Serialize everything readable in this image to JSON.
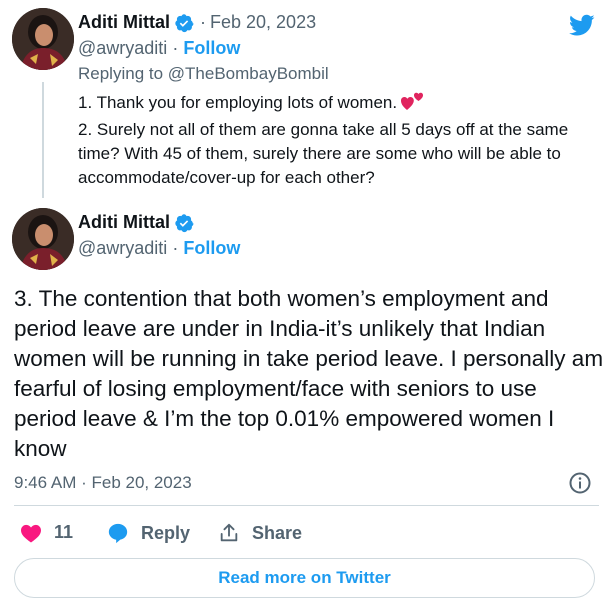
{
  "brand": {
    "accent": "#1d9bf0",
    "heart": "#f91880",
    "icon": "twitter-bird-icon"
  },
  "reply_tweet": {
    "author_name": "Aditi Mittal",
    "date": "Feb 20, 2023",
    "handle": "@awryaditi",
    "separator": "·",
    "follow_label": "Follow",
    "replying_to": "Replying to @TheBombayBombil",
    "lines": [
      "1. Thank you for employing lots of women.",
      "2. Surely not all of them are gonna take all 5 days off at the same time? With 45 of them, surely there are some who will be able to accommodate/cover-up for each other?"
    ]
  },
  "main_tweet": {
    "author_name": "Aditi Mittal",
    "handle": "@awryaditi",
    "separator": "·",
    "follow_label": "Follow",
    "text": "3. The contention that both women’s employment and period leave are under in India-it’s unlikely that Indian women will be running in take period leave. I personally am fearful of losing employment/face with seniors to use period leave & I’m the top 0.01% empowered women I know",
    "timestamp": "9:46 AM · Feb 20, 2023"
  },
  "actions": {
    "like_count": "11",
    "reply_label": "Reply",
    "share_label": "Share",
    "read_more_label": "Read more on Twitter"
  }
}
